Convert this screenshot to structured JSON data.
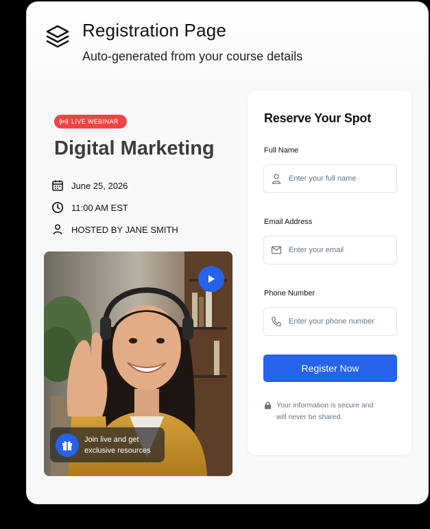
{
  "header": {
    "title": "Registration Page",
    "subtitle": "Auto-generated from your course details",
    "logo_icon": "layers-icon"
  },
  "course": {
    "badge": "LIVE WEBINAR",
    "badge_color": "#ef4444",
    "title": "Digital Marketing",
    "date": "June 25, 2026",
    "time": "11:00 AM EST",
    "host": "HOSTED BY JANE SMITH",
    "promo_text_line1": "Join live and get",
    "promo_text_line2": "exclusive resources"
  },
  "form": {
    "title": "Reserve Your Spot",
    "full_name_label": "Full Name",
    "full_name_placeholder": "Enter your full name",
    "email_label": "Email Address",
    "email_placeholder": "Enter your email",
    "phone_label": "Phone Number",
    "phone_placeholder": "Enter your phone number",
    "submit_label": "Register Now",
    "secure_line1": "Your information is secure and",
    "secure_line2": "will never be shared."
  },
  "colors": {
    "accent": "#2563eb",
    "badge": "#ef4444"
  }
}
